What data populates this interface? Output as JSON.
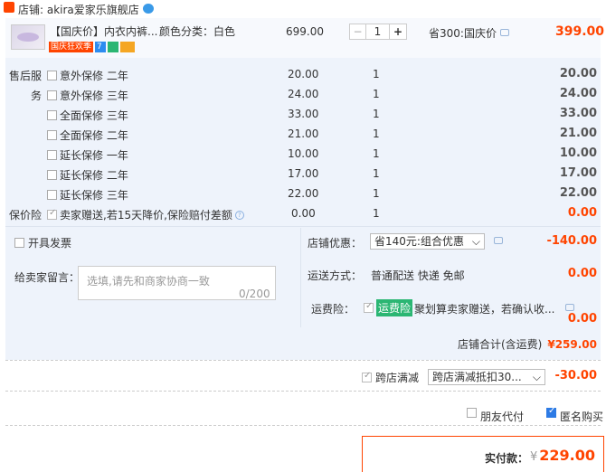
{
  "store": {
    "label": "店铺: akira爱家乐旗舰店"
  },
  "product": {
    "title": "【国庆价】内衣内裤...",
    "tag_text": "国庆狂欢季",
    "sku": "颜色分类：白色",
    "price": "699.00",
    "qty": "1",
    "discount": "省300:国庆价",
    "subtotal": "399.00"
  },
  "services": {
    "label_line1": "售后服",
    "label_line2": "务",
    "items": [
      {
        "name": "意外保修  二年",
        "price": "20.00",
        "qty": "1",
        "sum": "20.00"
      },
      {
        "name": "意外保修  三年",
        "price": "24.00",
        "qty": "1",
        "sum": "24.00"
      },
      {
        "name": "全面保修  三年",
        "price": "33.00",
        "qty": "1",
        "sum": "33.00"
      },
      {
        "name": "全面保修  二年",
        "price": "21.00",
        "qty": "1",
        "sum": "21.00"
      },
      {
        "name": "延长保修  一年",
        "price": "10.00",
        "qty": "1",
        "sum": "10.00"
      },
      {
        "name": "延长保修  二年",
        "price": "17.00",
        "qty": "1",
        "sum": "17.00"
      },
      {
        "name": "延长保修  三年",
        "price": "22.00",
        "qty": "1",
        "sum": "22.00"
      }
    ]
  },
  "insurance_row": {
    "label": "保价险",
    "name": "卖家赠送,若15天降价,保险赔付差额",
    "price": "0.00",
    "qty": "1",
    "sum": "0.00"
  },
  "invoice": {
    "label": "开具发票"
  },
  "shop_coupon": {
    "label": "店铺优惠：",
    "selected": "省140元:组合优惠",
    "value": "-140.00"
  },
  "message": {
    "label": "给卖家留言：",
    "placeholder": "选填,请先和商家协商一致",
    "count": "0/200"
  },
  "shipping": {
    "label": "运送方式：",
    "value": "普通配送 快递 免邮",
    "amount": "0.00"
  },
  "freight_ins": {
    "label": "运费险：",
    "badge": "运费险",
    "text": "聚划算卖家赠送，若确认收...",
    "amount": "0.00"
  },
  "store_total": {
    "label": "店铺合计(含运费)",
    "amount": "¥259.00"
  },
  "cross_store": {
    "label": "跨店满减",
    "selected": "跨店满减抵扣30...",
    "value": "-30.00"
  },
  "options": {
    "friend_pay": "朋友代付",
    "anonymous": "匿名购买"
  },
  "payment": {
    "label": "实付款：",
    "currency": "¥",
    "amount": "229.00"
  },
  "colors": {
    "accent": "#ff4400",
    "panel": "#eef3fb",
    "badge_green": "#2bb673"
  }
}
